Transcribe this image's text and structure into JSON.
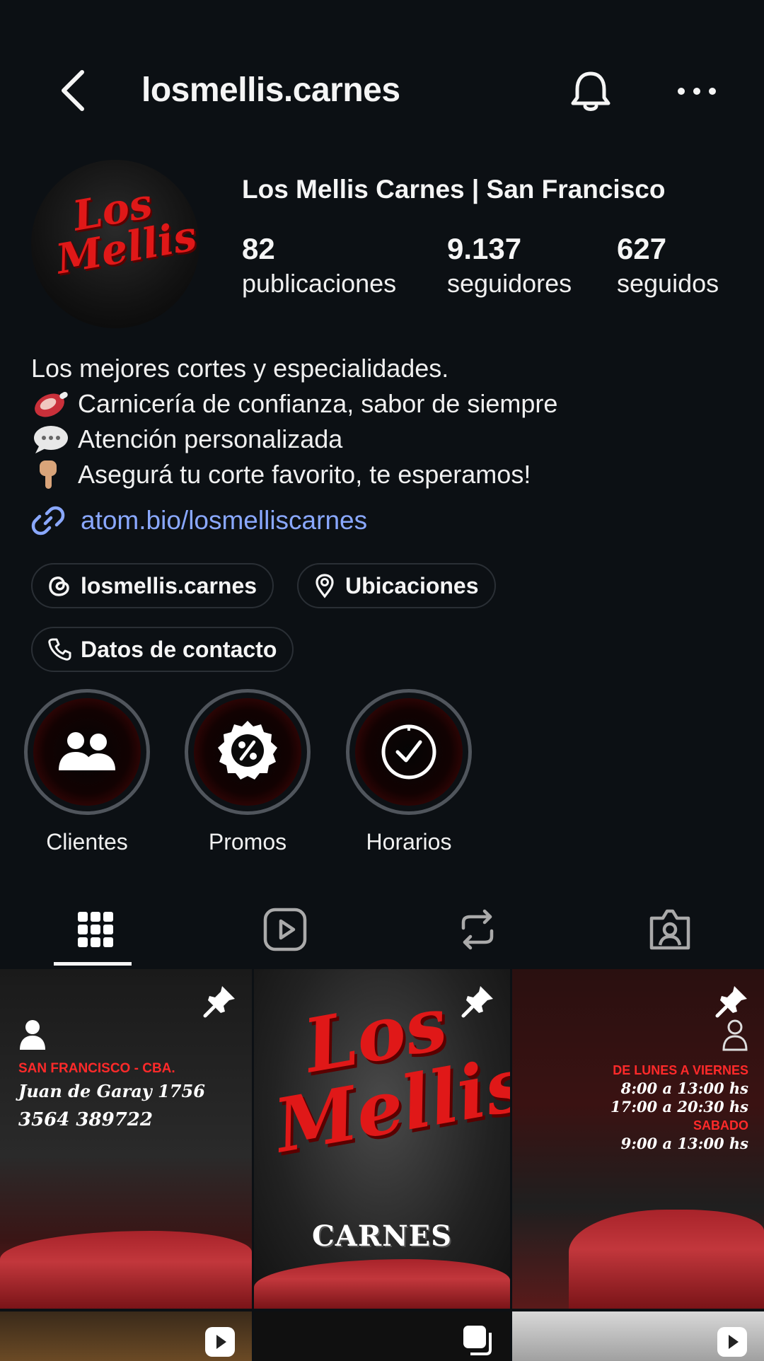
{
  "header": {
    "title": "losmellis.carnes"
  },
  "profile": {
    "name": "Los Mellis Carnes | San Francisco",
    "avatar_text": [
      "Los",
      "Mellis"
    ],
    "stats": [
      {
        "value": "82",
        "label": "publicaciones"
      },
      {
        "value": "9.137",
        "label": "seguidores"
      },
      {
        "value": "627",
        "label": "seguidos"
      }
    ],
    "bio": [
      "Los mejores cortes y especialidades.",
      "Carnicería de confianza, sabor de siempre",
      "Atención personalizada",
      "Asegurá tu corte favorito, te esperamos!"
    ],
    "link": "atom.bio/losmelliscarnes"
  },
  "chips": {
    "threads": "losmellis.carnes",
    "locations": "Ubicaciones",
    "contact": "Datos de contacto"
  },
  "highlights": [
    {
      "label": "Clientes",
      "icon": "users-icon"
    },
    {
      "label": "Promos",
      "icon": "percent-badge-icon"
    },
    {
      "label": "Horarios",
      "icon": "clock-icon"
    }
  ],
  "tabs": [
    {
      "icon": "grid-icon",
      "active": true
    },
    {
      "icon": "reels-icon"
    },
    {
      "icon": "reposts-icon"
    },
    {
      "icon": "tagged-icon"
    }
  ],
  "posts": {
    "p1": {
      "city": "SAN FRANCISCO - CBA.",
      "address": "Juan de Garay 1756",
      "phone": "3564 389722"
    },
    "p2": {
      "logo": [
        "Los",
        "Mellis"
      ],
      "caption": "CARNES"
    },
    "p3": {
      "days": "DE LUNES A VIERNES",
      "h1": "8:00 a 13:00 hs",
      "h2": "17:00 a 20:30 hs",
      "sat": "SABADO",
      "h3": "9:00 a 13:00 hs"
    }
  },
  "colors": {
    "background": "#0c1014",
    "link": "#8aa8ff",
    "brand_red": "#e01818"
  }
}
